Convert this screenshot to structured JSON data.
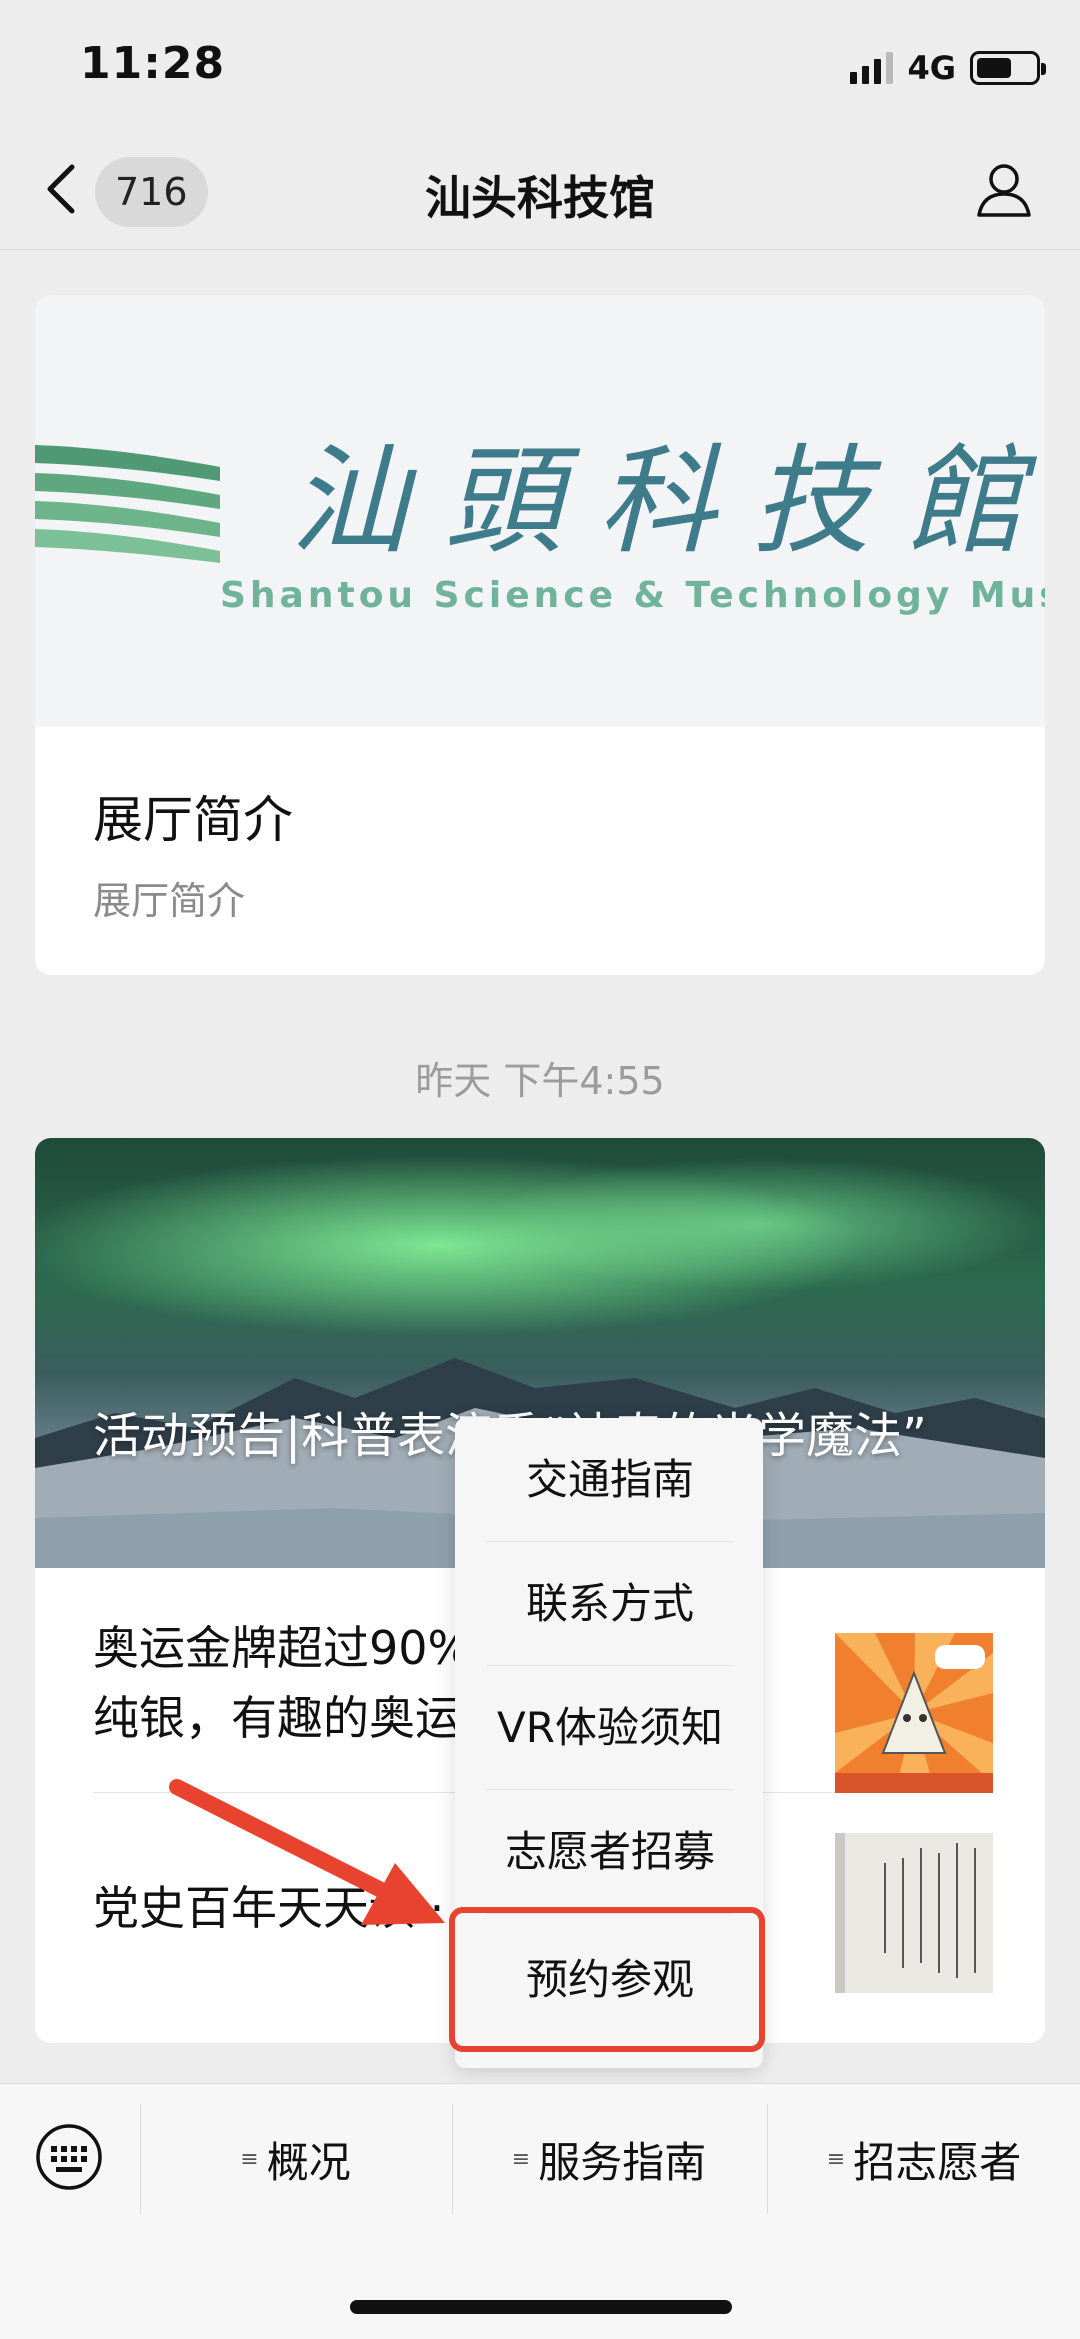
{
  "status_bar": {
    "time": "11:28",
    "network": "4G",
    "battery_level": 0.6
  },
  "nav": {
    "back_count": "716",
    "title": "汕头科技馆"
  },
  "intro_card": {
    "logo_cn": "汕頭科技館",
    "logo_en": "Shantou Science & Technology  Museum",
    "title": "展厅简介",
    "subtitle": "展厅简介"
  },
  "timestamp": "昨天 下午4:55",
  "article_card": {
    "main_title": "活动预告|科普表演秀“神奇的光学魔法”",
    "items": [
      {
        "title": "奥运金牌超过90%都是镀金的纯银，有趣的奥运冷知识"
      },
      {
        "title": "党史百年天天读 · "
      }
    ]
  },
  "popup_menu": {
    "items": [
      "交通指南",
      "联系方式",
      "VR体验须知",
      "志愿者招募",
      "预约参观"
    ]
  },
  "bottom_menu": {
    "tabs": [
      "概况",
      "服务指南",
      "招志愿者"
    ]
  },
  "colors": {
    "highlight": "#e8432f",
    "logo_blue": "#3f7c8b",
    "logo_green": "#6fb39a"
  }
}
